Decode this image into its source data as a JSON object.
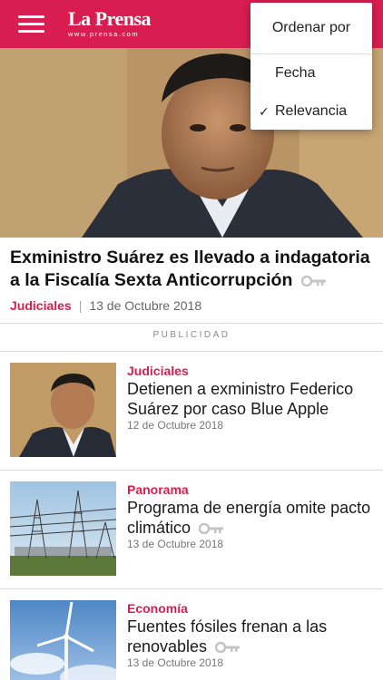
{
  "header": {
    "logo_main": "La Prensa",
    "logo_sub": "www.prensa.com",
    "brand_color": "#d81e50"
  },
  "sort_menu": {
    "title": "Ordenar por",
    "options": [
      {
        "label": "Fecha",
        "selected": false
      },
      {
        "label": "Relevancia",
        "selected": true
      }
    ],
    "check": "✓"
  },
  "featured": {
    "headline": "Exministro Suárez es llevado a indagatoria a la Fiscalía Sexta Anticorrupción",
    "category": "Judiciales",
    "separator": "|",
    "date": "13 de Octubre 2018",
    "premium_icon": "key-icon"
  },
  "ad_label": "PUBLICIDAD",
  "articles": [
    {
      "category": "Judiciales",
      "title": "Detienen a exministro Federico Suárez por caso Blue Apple",
      "date": "12 de Octubre 2018",
      "premium": false
    },
    {
      "category": "Panorama",
      "title": "Programa de energía omite pacto climático",
      "date": "13 de Octubre 2018",
      "premium": true
    },
    {
      "category": "Economía",
      "title": "Fuentes fósiles frenan a las renovables",
      "date": "13 de Octubre 2018",
      "premium": true
    }
  ]
}
